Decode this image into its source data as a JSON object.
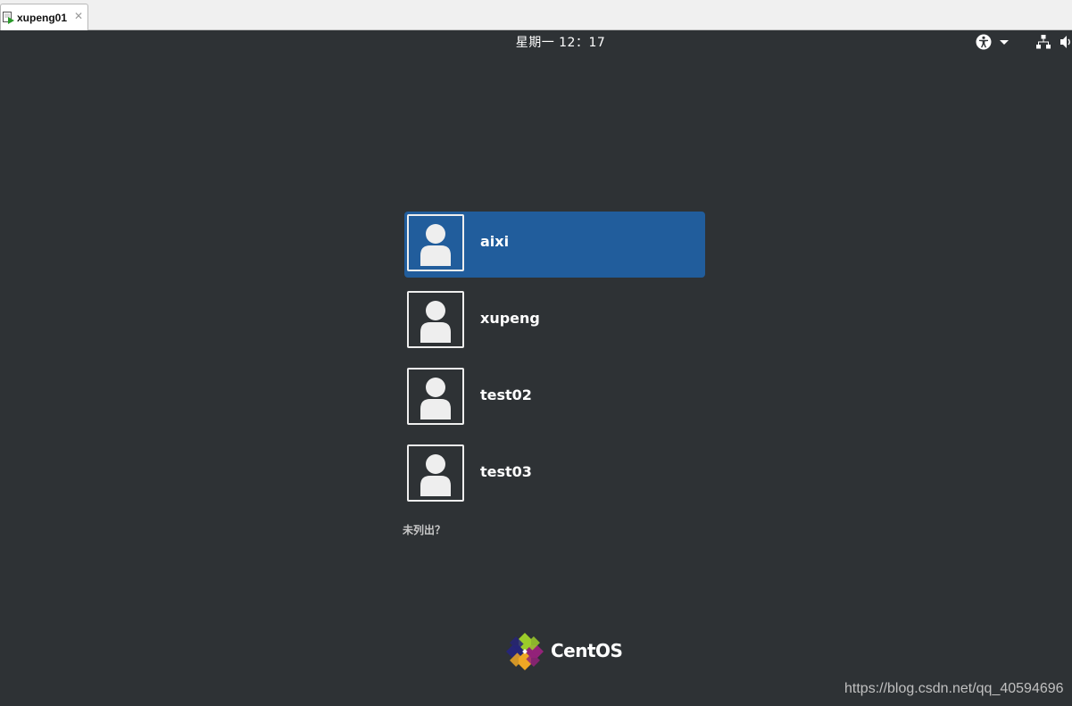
{
  "vm_tab": {
    "title": "xupeng01",
    "close_glyph": "✕"
  },
  "topbar": {
    "clock": "星期一 12：17",
    "icons": [
      "accessibility-icon",
      "chevron-down-icon",
      "network-icon",
      "volume-icon"
    ]
  },
  "users": [
    {
      "name": "aixi",
      "selected": true
    },
    {
      "name": "xupeng",
      "selected": false
    },
    {
      "name": "test02",
      "selected": false
    },
    {
      "name": "test03",
      "selected": false
    }
  ],
  "not_listed_label": "未列出？",
  "branding": {
    "logo_text": "CentOS"
  },
  "watermark": "https://blog.csdn.net/qq_40594696",
  "colors": {
    "background": "#2e3235",
    "selection": "#215d9c",
    "text": "#ffffff"
  }
}
